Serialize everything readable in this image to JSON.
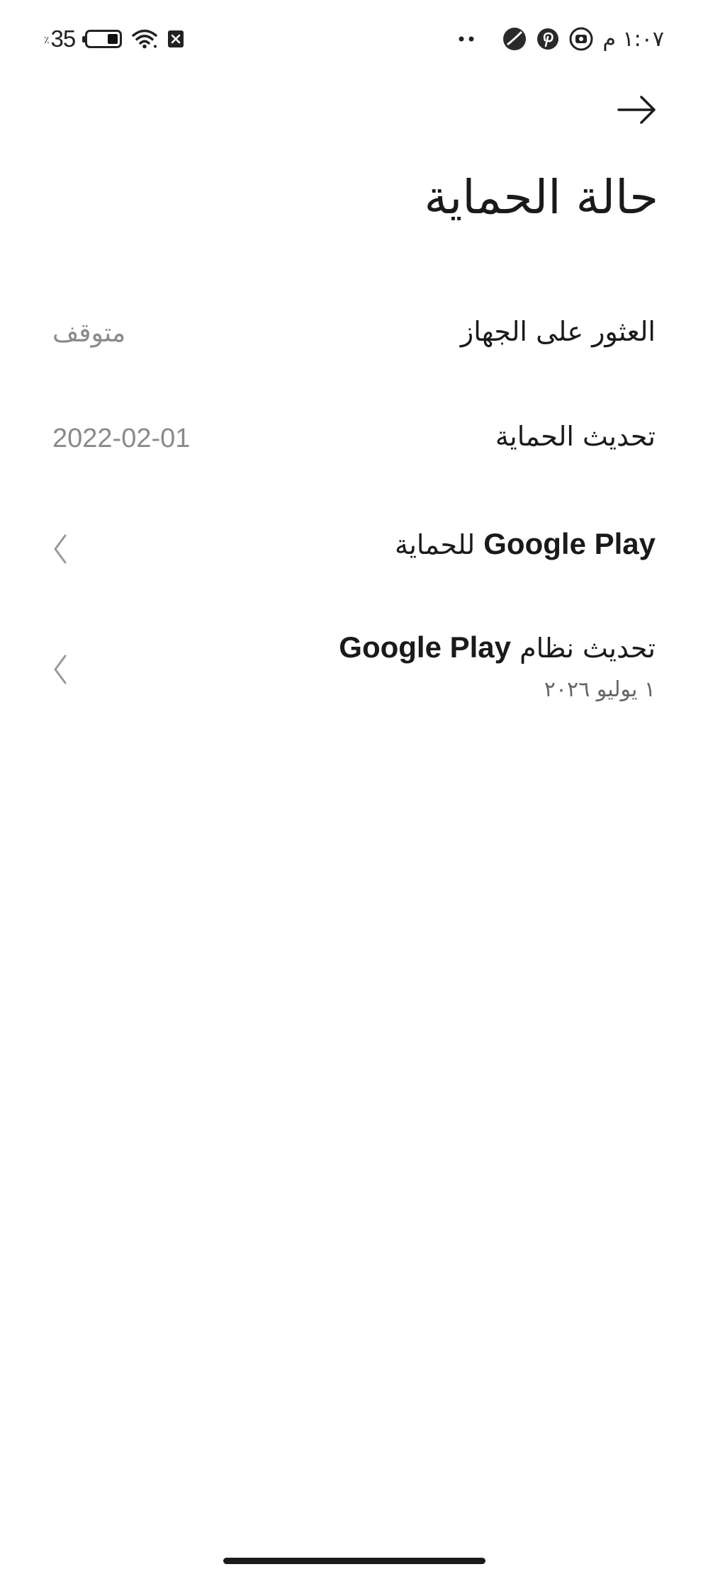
{
  "status_bar": {
    "battery_level": "35",
    "battery_percent_sign": "٪",
    "time": "١:٠٧ م",
    "icons": [
      "battery-icon",
      "wifi-icon",
      "sim-x-icon",
      "more-dots-icon",
      "app-notification-icon",
      "pinterest-icon",
      "screen-record-icon"
    ]
  },
  "header": {
    "title": "حالة الحماية"
  },
  "rows": [
    {
      "label": "العثور على الجهاز",
      "value": "متوقف"
    },
    {
      "label": "تحديث الحماية",
      "value": "2022-02-01"
    },
    {
      "label_prefix": "Google Play",
      "label_suffix": "للحماية"
    },
    {
      "label_prefix": "تحديث نظام",
      "label_suffix": "Google Play",
      "sub": "١ يوليو ٢٠٢٦"
    }
  ]
}
